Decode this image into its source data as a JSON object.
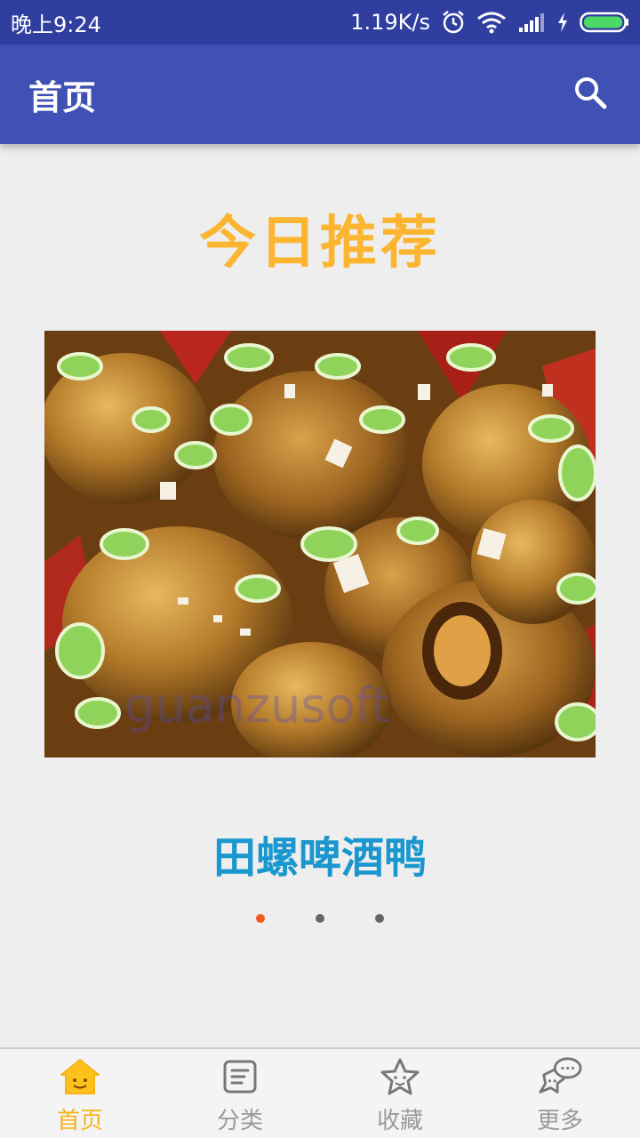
{
  "status_bar": {
    "time": "晚上9:24",
    "speed": "1.19K/s",
    "icons": [
      "alarm-icon",
      "wifi-icon",
      "signal-icon",
      "charging-icon",
      "battery-icon"
    ]
  },
  "app_bar": {
    "title": "首页",
    "search_icon": "search-icon",
    "color": "#3f51b5"
  },
  "recommendation": {
    "heading": "今日推荐",
    "heading_color": "#fbb531",
    "dish_name": "田螺啤酒鸭",
    "dish_name_color": "#1a97cf",
    "image_watermark": "guanzusoft",
    "carousel": {
      "page_count": 3,
      "active_index": 0,
      "active_color": "#f15a22",
      "inactive_color": "#666666"
    }
  },
  "bottom_nav": {
    "active_color": "#f9b21a",
    "items": [
      {
        "label": "首页",
        "icon": "home-icon",
        "active": true
      },
      {
        "label": "分类",
        "icon": "category-list-icon",
        "active": false
      },
      {
        "label": "收藏",
        "icon": "star-favorite-icon",
        "active": false
      },
      {
        "label": "更多",
        "icon": "chat-more-icon",
        "active": false
      }
    ]
  }
}
